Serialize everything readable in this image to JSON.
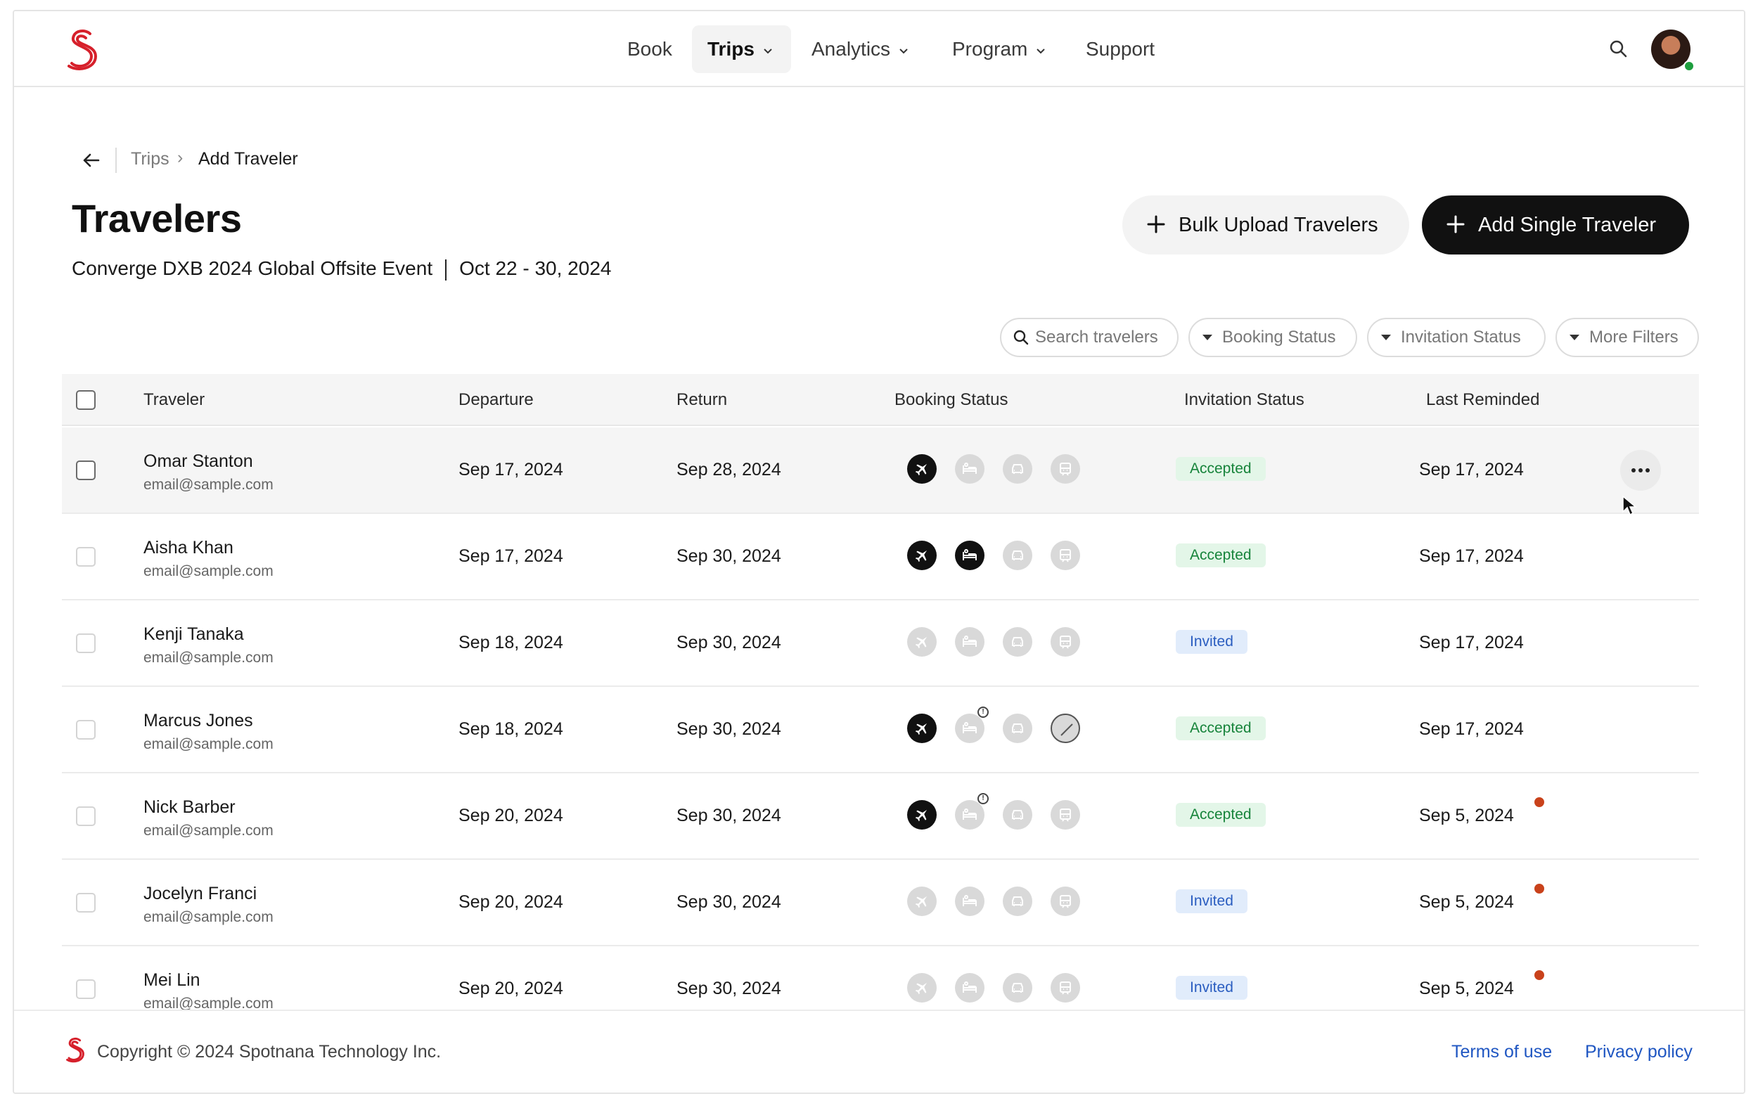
{
  "brand": {
    "accent": "#d6202b",
    "logo_icon": "spotnana-s-logo"
  },
  "nav": {
    "items": [
      {
        "label": "Book"
      },
      {
        "label": "Trips",
        "active": true,
        "has_menu": true
      },
      {
        "label": "Analytics",
        "has_menu": true
      },
      {
        "label": "Program",
        "has_menu": true
      },
      {
        "label": "Support"
      }
    ],
    "search_icon": "search-icon",
    "avatar_status_color": "#1e9e3e"
  },
  "breadcrumb": {
    "parent": "Trips",
    "separator": "›",
    "current": "Add Traveler"
  },
  "page": {
    "title": "Travelers",
    "event_name": "Converge DXB 2024 Global Offsite Event",
    "event_dates": "Oct 22 - 30, 2024"
  },
  "actions": {
    "bulk_upload_label": "Bulk Upload Travelers",
    "add_single_label": "Add Single Traveler"
  },
  "filters": {
    "search_placeholder": "Search travelers",
    "booking_status": "Booking Status",
    "invitation_status": "Invitation Status",
    "more_filters": "More Filters"
  },
  "table": {
    "headers": {
      "traveler": "Traveler",
      "departure": "Departure",
      "return": "Return",
      "booking_status": "Booking Status",
      "invitation_status": "Invitation Status",
      "last_reminded": "Last Reminded"
    },
    "status_colors": {
      "booked": "#111111",
      "unbooked": "#d9d9d9",
      "reminder_dot": "#c9421b"
    },
    "rows": [
      {
        "name": "Omar Stanton",
        "email": "email@sample.com",
        "departure": "Sep 17, 2024",
        "return": "Sep 28, 2024",
        "booking": {
          "flight": "booked",
          "hotel": "none",
          "car": "none",
          "rail": "none"
        },
        "invitation": "Accepted",
        "last_reminded": "Sep 17, 2024",
        "hovered": true
      },
      {
        "name": "Aisha Khan",
        "email": "email@sample.com",
        "departure": "Sep 17, 2024",
        "return": "Sep 30, 2024",
        "booking": {
          "flight": "booked",
          "hotel": "booked",
          "car": "none",
          "rail": "none"
        },
        "invitation": "Accepted",
        "last_reminded": "Sep 17, 2024"
      },
      {
        "name": "Kenji Tanaka",
        "email": "email@sample.com",
        "departure": "Sep 18, 2024",
        "return": "Sep 30, 2024",
        "booking": {
          "flight": "none",
          "hotel": "none",
          "car": "none",
          "rail": "none"
        },
        "invitation": "Invited",
        "last_reminded": "Sep 17, 2024"
      },
      {
        "name": "Marcus Jones",
        "email": "email@sample.com",
        "departure": "Sep 18, 2024",
        "return": "Sep 30, 2024",
        "booking": {
          "flight": "booked",
          "hotel": "alert",
          "car": "none",
          "rail": "not-needed"
        },
        "invitation": "Accepted",
        "last_reminded": "Sep 17, 2024"
      },
      {
        "name": "Nick Barber",
        "email": "email@sample.com",
        "departure": "Sep 20, 2024",
        "return": "Sep 30, 2024",
        "booking": {
          "flight": "booked",
          "hotel": "alert",
          "car": "none",
          "rail": "none"
        },
        "invitation": "Accepted",
        "last_reminded": "Sep 5, 2024",
        "reminder_dot": true
      },
      {
        "name": "Jocelyn Franci",
        "email": "email@sample.com",
        "departure": "Sep 20, 2024",
        "return": "Sep 30, 2024",
        "booking": {
          "flight": "none",
          "hotel": "none",
          "car": "none",
          "rail": "none"
        },
        "invitation": "Invited",
        "last_reminded": "Sep 5, 2024",
        "reminder_dot": true
      },
      {
        "name": "Mei Lin",
        "email": "email@sample.com",
        "departure": "Sep 20, 2024",
        "return": "Sep 30, 2024",
        "booking": {
          "flight": "none",
          "hotel": "none",
          "car": "none",
          "rail": "none"
        },
        "invitation": "Invited",
        "last_reminded": "Sep 5, 2024",
        "reminder_dot": true
      }
    ]
  },
  "footer": {
    "copyright": "Copyright © 2024 Spotnana Technology Inc.",
    "terms": "Terms of use",
    "privacy": "Privacy policy"
  }
}
